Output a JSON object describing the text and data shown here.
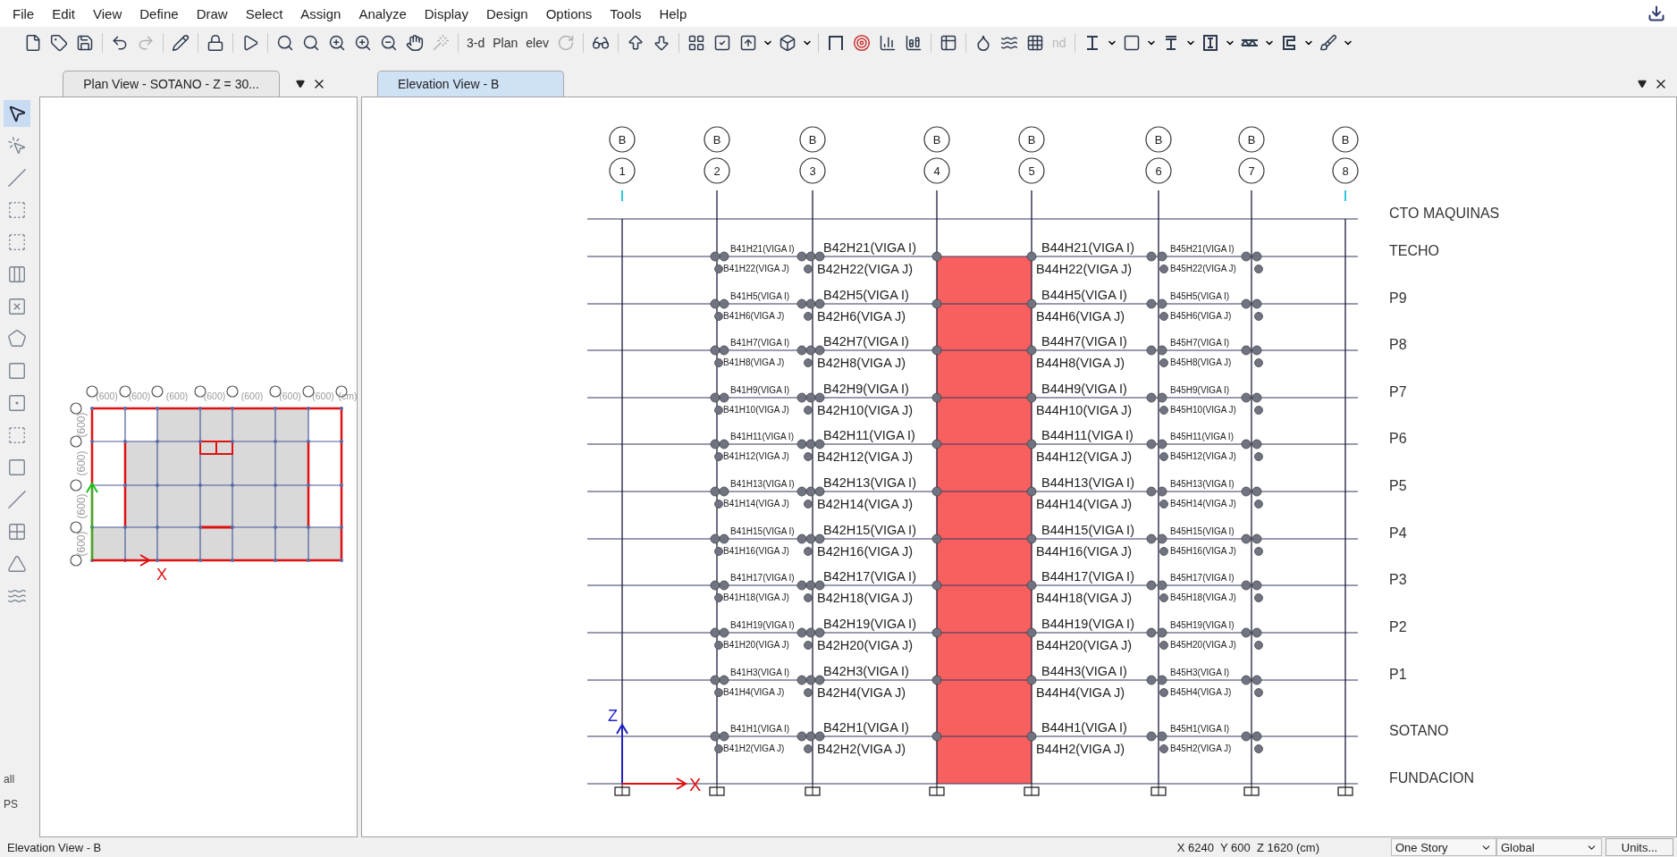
{
  "menu": [
    "File",
    "Edit",
    "View",
    "Define",
    "Draw",
    "Select",
    "Assign",
    "Analyze",
    "Display",
    "Design",
    "Options",
    "Tools",
    "Help"
  ],
  "toolbar_labels": [
    {
      "label": "3-d",
      "disabled": false
    },
    {
      "label": "Plan",
      "disabled": false
    },
    {
      "label": "elev",
      "disabled": false
    },
    {
      "label": "nd",
      "disabled": true
    }
  ],
  "left_toolbar_labels": [
    "all",
    "PS"
  ],
  "plan_panel": {
    "tab": {
      "label": "Plan View - SOTANO - Z = 30...",
      "selected": false
    },
    "dimensions_top": [
      "(600)",
      "(600)",
      "(600)",
      "(600)",
      "(600)",
      "(600)",
      "(600)",
      "(cm)"
    ],
    "dimensions_left": [
      "(600)",
      "(600)",
      "(600)",
      "(600)"
    ],
    "axis_label": "X"
  },
  "elevation_panel": {
    "tab": {
      "label": "Elevation View - B",
      "selected": true
    },
    "grid_lines": [
      {
        "letter": "B",
        "number": "1"
      },
      {
        "letter": "B",
        "number": "2"
      },
      {
        "letter": "B",
        "number": "3"
      },
      {
        "letter": "B",
        "number": "4"
      },
      {
        "letter": "B",
        "number": "5"
      },
      {
        "letter": "B",
        "number": "6"
      },
      {
        "letter": "B",
        "number": "7"
      },
      {
        "letter": "B",
        "number": "8"
      }
    ],
    "stories": [
      {
        "name": "CTO MAQUINAS"
      },
      {
        "name": "TECHO",
        "beams_above": [
          "B41H21(VIGA I)",
          "B42H21(VIGA I)",
          "B44H21(VIGA I)",
          "B45H21(VIGA I)"
        ],
        "beams_below": [
          "B41H22(VIGA J)",
          "B42H22(VIGA J)",
          "B44H22(VIGA J)",
          "B45H22(VIGA J)"
        ]
      },
      {
        "name": "P9",
        "beams_above": [
          "B41H5(VIGA I)",
          "B42H5(VIGA I)",
          "B44H5(VIGA I)",
          "B45H5(VIGA I)"
        ],
        "beams_below": [
          "B41H6(VIGA J)",
          "B42H6(VIGA J)",
          "B44H6(VIGA J)",
          "B45H6(VIGA J)"
        ]
      },
      {
        "name": "P8",
        "beams_above": [
          "B41H7(VIGA I)",
          "B42H7(VIGA I)",
          "B44H7(VIGA I)",
          "B45H7(VIGA I)"
        ],
        "beams_below": [
          "B41H8(VIGA J)",
          "B42H8(VIGA J)",
          "B44H8(VIGA J)",
          "B45H8(VIGA J)"
        ]
      },
      {
        "name": "P7",
        "beams_above": [
          "B41H9(VIGA I)",
          "B42H9(VIGA I)",
          "B44H9(VIGA I)",
          "B45H9(VIGA I)"
        ],
        "beams_below": [
          "B41H10(VIGA J)",
          "B42H10(VIGA J)",
          "B44H10(VIGA J)",
          "B45H10(VIGA J)"
        ]
      },
      {
        "name": "P6",
        "beams_above": [
          "B41H11(VIGA I)",
          "B42H11(VIGA I)",
          "B44H11(VIGA I)",
          "B45H11(VIGA I)"
        ],
        "beams_below": [
          "B41H12(VIGA J)",
          "B42H12(VIGA J)",
          "B44H12(VIGA J)",
          "B45H12(VIGA J)"
        ]
      },
      {
        "name": "P5",
        "beams_above": [
          "B41H13(VIGA I)",
          "B42H13(VIGA I)",
          "B44H13(VIGA I)",
          "B45H13(VIGA I)"
        ],
        "beams_below": [
          "B41H14(VIGA J)",
          "B42H14(VIGA J)",
          "B44H14(VIGA J)",
          "B45H14(VIGA J)"
        ]
      },
      {
        "name": "P4",
        "beams_above": [
          "B41H15(VIGA I)",
          "B42H15(VIGA I)",
          "B44H15(VIGA I)",
          "B45H15(VIGA I)"
        ],
        "beams_below": [
          "B41H16(VIGA J)",
          "B42H16(VIGA J)",
          "B44H16(VIGA J)",
          "B45H16(VIGA J)"
        ]
      },
      {
        "name": "P3",
        "beams_above": [
          "B41H17(VIGA I)",
          "B42H17(VIGA I)",
          "B44H17(VIGA I)",
          "B45H17(VIGA I)"
        ],
        "beams_below": [
          "B41H18(VIGA J)",
          "B42H18(VIGA J)",
          "B44H18(VIGA J)",
          "B45H18(VIGA J)"
        ]
      },
      {
        "name": "P2",
        "beams_above": [
          "B41H19(VIGA I)",
          "B42H19(VIGA I)",
          "B44H19(VIGA I)",
          "B45H19(VIGA I)"
        ],
        "beams_below": [
          "B41H20(VIGA J)",
          "B42H20(VIGA J)",
          "B44H20(VIGA J)",
          "B45H20(VIGA J)"
        ]
      },
      {
        "name": "P1",
        "beams_above": [
          "B41H3(VIGA I)",
          "B42H3(VIGA I)",
          "B44H3(VIGA I)",
          "B45H3(VIGA I)"
        ],
        "beams_below": [
          "B41H4(VIGA J)",
          "B42H4(VIGA J)",
          "B44H4(VIGA J)",
          "B45H4(VIGA J)"
        ]
      },
      {
        "name": "SOTANO",
        "beams_above": [
          "B41H1(VIGA I)",
          "B42H1(VIGA I)",
          "B44H1(VIGA I)",
          "B45H1(VIGA I)"
        ],
        "beams_below": [
          "B41H2(VIGA J)",
          "B42H2(VIGA J)",
          "B44H2(VIGA J)",
          "B45H2(VIGA J)"
        ]
      },
      {
        "name": "FUNDACION"
      }
    ],
    "axis_labels": [
      "Z",
      "X"
    ]
  },
  "status_bar": {
    "view": "Elevation View - B",
    "coordinates": "X 6240  Y 600  Z 1620 (cm)",
    "story_mode": "One Story",
    "coordinate_system": "Global",
    "units_button": "Units..."
  }
}
